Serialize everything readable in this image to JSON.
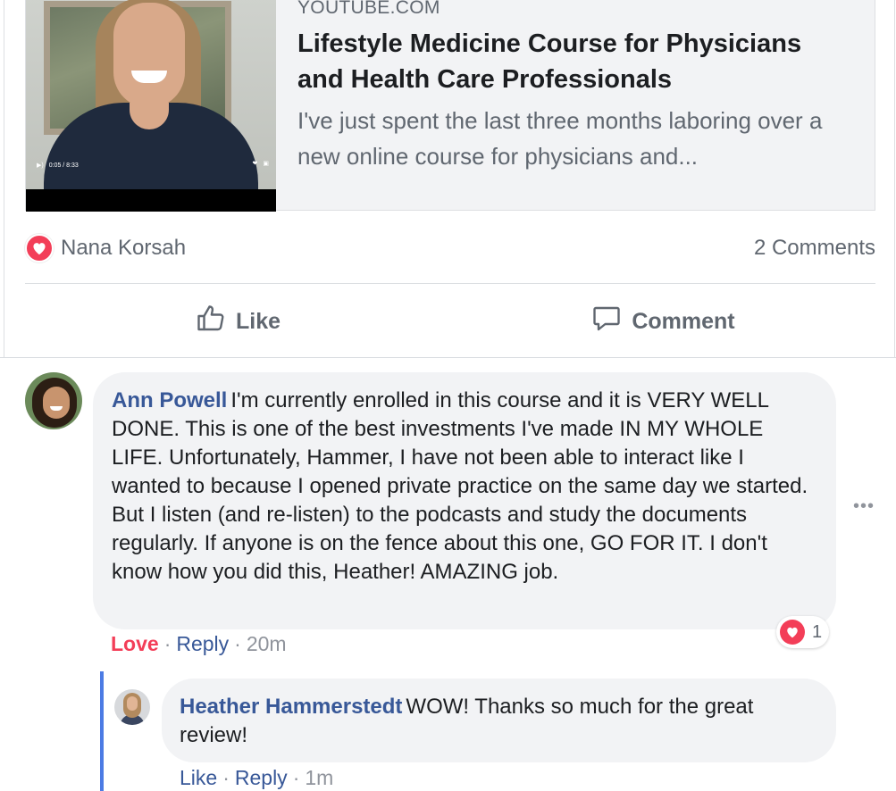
{
  "link_preview": {
    "site": "YOUTUBE.COM",
    "title": "Lifestyle Medicine Course for Physicians and Health Care Professionals",
    "description": "I've just spent the last three months laboring over a new online course for physicians and...",
    "video_time": "0:05 / 8:33"
  },
  "reactions": {
    "reactor_name": "Nana Korsah",
    "comments_count": "2 Comments"
  },
  "actions": {
    "like_label": "Like",
    "comment_label": "Comment"
  },
  "comments": [
    {
      "author": "Ann Powell",
      "text": "I'm currently enrolled in this course and it is VERY WELL DONE. This is one of the best investments I've made IN MY WHOLE LIFE. Unfortunately, Hammer, I have not been able to interact like I wanted to because I opened private practice on the same day we started. But I listen (and re-listen) to the podcasts and study the documents regularly. If anyone is on the fence about this one, GO FOR IT. I don't know how you did this, Heather! AMAZING job.",
      "love_label": "Love",
      "reply_label": "Reply",
      "time": "20m",
      "reaction_count": "1"
    }
  ],
  "reply": {
    "author": "Heather Hammerstedt",
    "text": "WOW! Thanks so much for the great review!",
    "like_label": "Like",
    "reply_label": "Reply",
    "time": "1m"
  },
  "colors": {
    "link_blue": "#385898",
    "love_red": "#f33e58",
    "muted_gray": "#606770",
    "bubble_bg": "#f2f3f5",
    "thread_line": "#4c7be4"
  }
}
